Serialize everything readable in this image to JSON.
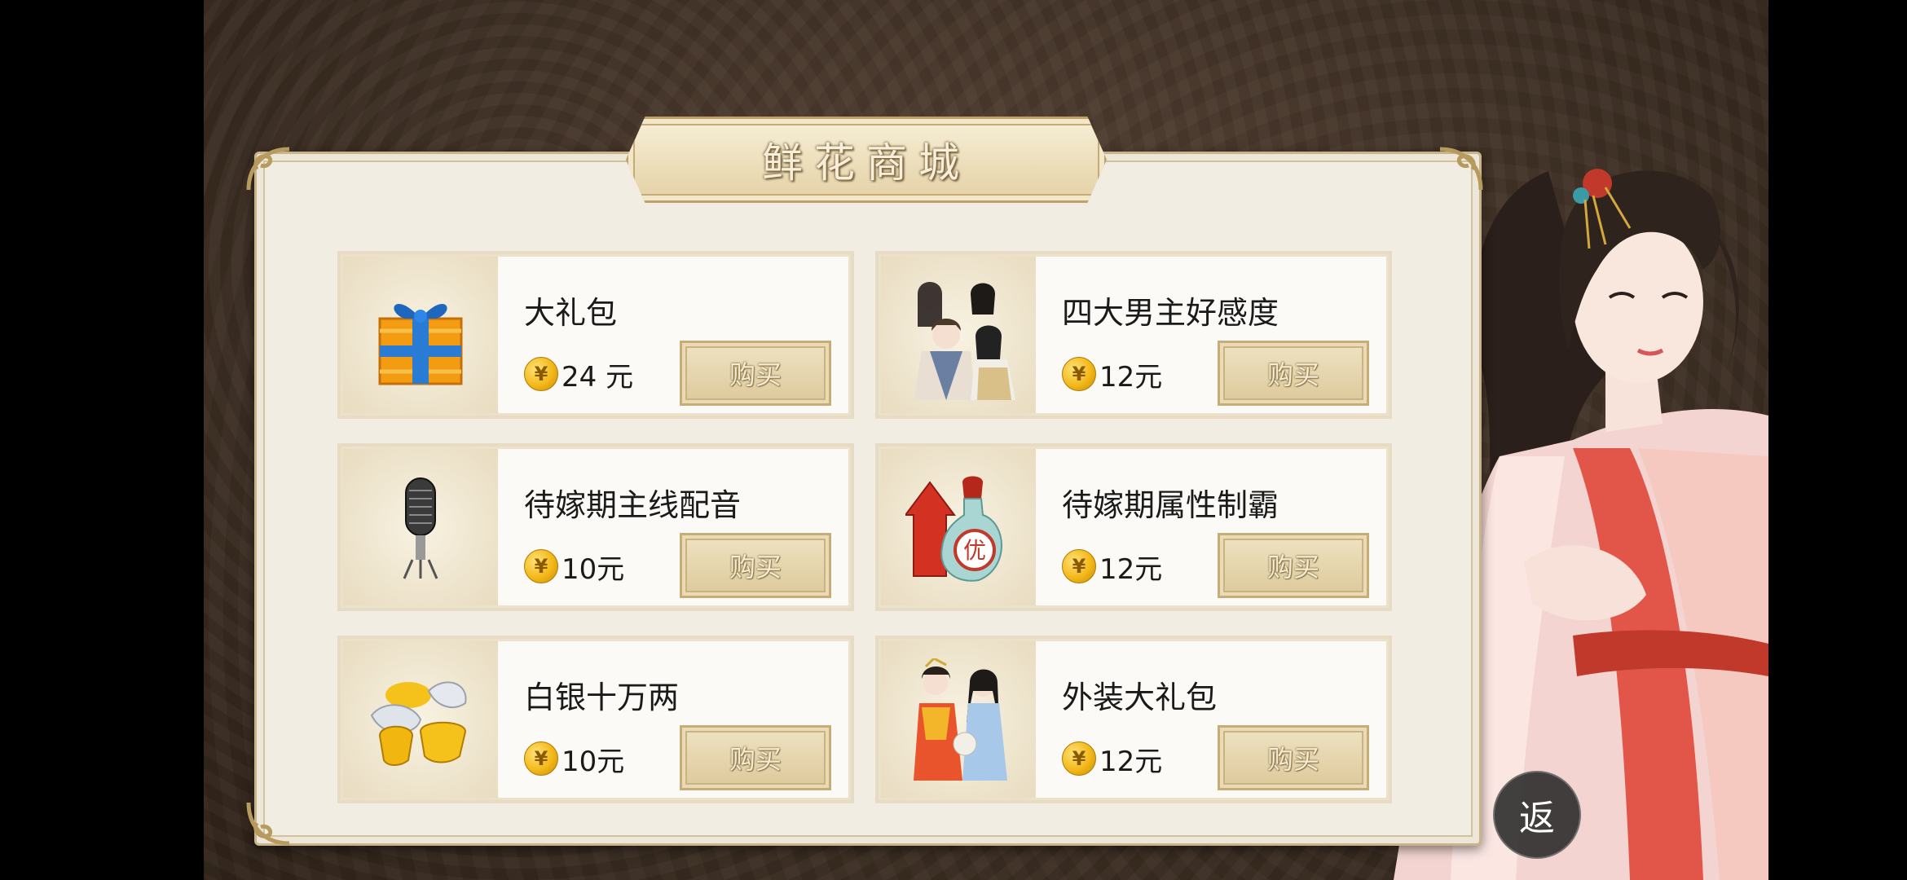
{
  "shop": {
    "title": "鲜花商城",
    "buy_label": "购买",
    "currency_symbol": "¥",
    "items": [
      {
        "name": "大礼包",
        "price": "24 元",
        "icon": "gift-box-icon"
      },
      {
        "name": "四大男主好感度",
        "price": "12元",
        "icon": "four-heroes-portrait"
      },
      {
        "name": "待嫁期主线配音",
        "price": "10元",
        "icon": "microphone-icon"
      },
      {
        "name": "待嫁期属性制霸",
        "price": "12元",
        "icon": "potion-bottle-icon"
      },
      {
        "name": "白银十万两",
        "price": "10元",
        "icon": "silver-ingot-icon"
      },
      {
        "name": "外装大礼包",
        "price": "12元",
        "icon": "costume-portrait"
      }
    ]
  },
  "back_button": {
    "label": "返"
  },
  "colors": {
    "coin": "#f3b818",
    "panel": "#f1ede3",
    "border": "#c9b48a"
  }
}
